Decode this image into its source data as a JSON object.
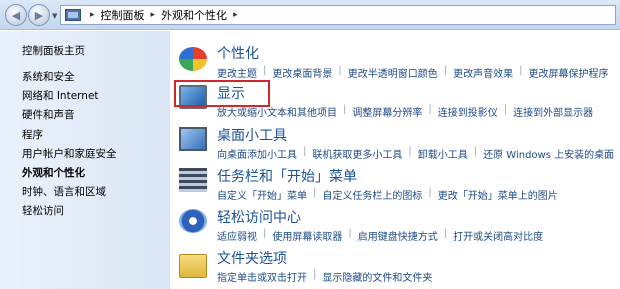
{
  "breadcrumb": {
    "items": [
      "控制面板",
      "外观和个性化"
    ],
    "separator": "▸"
  },
  "leftnav": {
    "home": "控制面板主页",
    "items": [
      {
        "label": "系统和安全",
        "current": false
      },
      {
        "label": "网络和 Internet",
        "current": false
      },
      {
        "label": "硬件和声音",
        "current": false
      },
      {
        "label": "程序",
        "current": false
      },
      {
        "label": "用户帐户和家庭安全",
        "current": false
      },
      {
        "label": "外观和个性化",
        "current": true
      },
      {
        "label": "时钟、语言和区域",
        "current": false
      },
      {
        "label": "轻松访问",
        "current": false
      }
    ]
  },
  "categories": [
    {
      "title": "个性化",
      "icon": "personalization-icon",
      "links": [
        "更改主题",
        "更改桌面背景",
        "更改半透明窗口颜色",
        "更改声音效果",
        "更改屏幕保护程序"
      ]
    },
    {
      "title": "显示",
      "icon": "display-icon",
      "links": [
        "放大或缩小文本和其他项目",
        "调整屏幕分辨率",
        "连接到投影仪",
        "连接到外部显示器"
      ]
    },
    {
      "title": "桌面小工具",
      "icon": "desktop-gadgets-icon",
      "links": [
        "向桌面添加小工具",
        "联机获取更多小工具",
        "卸载小工具",
        "还原 Windows 上安装的桌面"
      ]
    },
    {
      "title": "任务栏和「开始」菜单",
      "icon": "taskbar-icon",
      "links": [
        "自定义「开始」菜单",
        "自定义任务栏上的图标",
        "更改「开始」菜单上的图片"
      ]
    },
    {
      "title": "轻松访问中心",
      "icon": "ease-of-access-icon",
      "links": [
        "适应弱视",
        "使用屏幕读取器",
        "启用键盘快捷方式",
        "打开或关闭高对比度"
      ]
    },
    {
      "title": "文件夹选项",
      "icon": "folder-options-icon",
      "links": [
        "指定单击或双击打开",
        "显示隐藏的文件和文件夹"
      ]
    }
  ],
  "colors": {
    "link": "#1e4b86",
    "title": "#1a5296",
    "highlight_box": "#d1262a",
    "nav_background": "#dbe6f5"
  }
}
